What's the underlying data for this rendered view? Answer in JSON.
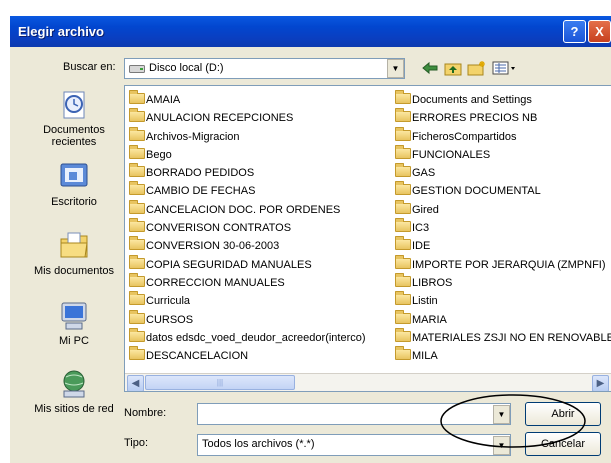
{
  "dialog": {
    "title": "Elegir archivo",
    "help_glyph": "?",
    "close_glyph": "X"
  },
  "lookin": {
    "label": "Buscar en:",
    "value": "Disco local (D:)"
  },
  "toolbar": {
    "icons": [
      "back-arrow-icon",
      "up-folder-icon",
      "new-folder-icon",
      "view-menu-icon"
    ]
  },
  "places": [
    {
      "label": "Documentos recientes",
      "icon": "recent-documents-icon"
    },
    {
      "label": "Escritorio",
      "icon": "desktop-icon"
    },
    {
      "label": "Mis documentos",
      "icon": "my-documents-icon"
    },
    {
      "label": "Mi PC",
      "icon": "my-computer-icon"
    },
    {
      "label": "Mis sitios de red",
      "icon": "network-places-icon"
    }
  ],
  "files": {
    "column1": [
      "AMAIA",
      "ANULACION RECEPCIONES",
      "Archivos-Migracion",
      "Bego",
      "BORRADO PEDIDOS",
      "CAMBIO DE FECHAS",
      "CANCELACION DOC. POR ORDENES",
      "CONVERISON CONTRATOS",
      "CONVERSION 30-06-2003",
      "COPIA SEGURIDAD MANUALES",
      "CORRECCION MANUALES",
      "Curricula",
      "CURSOS",
      "datos edsdc_voed_deudor_acreedor(interco)",
      "DESCANCELACION"
    ],
    "column2": [
      "Documents and Settings",
      "ERRORES PRECIOS NB",
      "FicherosCompartidos",
      "FUNCIONALES",
      "GAS",
      "GESTION DOCUMENTAL",
      "Gired",
      "IC3",
      "IDE",
      "IMPORTE POR JERARQUIA (ZMPNFI)",
      "LIBROS",
      "Listin",
      "MARIA",
      "MATERIALES ZSJI NO EN RENOVABLES",
      "MILA"
    ]
  },
  "filename": {
    "label": "Nombre:",
    "value": ""
  },
  "filetype": {
    "label": "Tipo:",
    "value": "Todos los archivos (*.*)"
  },
  "buttons": {
    "open": "Abrir",
    "cancel": "Cancelar"
  },
  "colors": {
    "title_bar": "#0a3fc1",
    "dialog_bg": "#ece9d8",
    "annotation_ellipse": "#000000"
  }
}
